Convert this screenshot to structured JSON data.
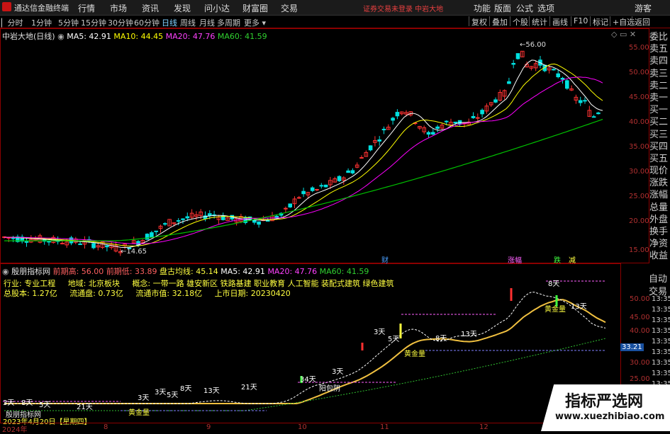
{
  "app": {
    "title": "通达信金融终端"
  },
  "menu": [
    "行情",
    "市场",
    "资讯",
    "发现",
    "问小达",
    "财富圈",
    "交易"
  ],
  "warning": "证券交易未登录  中岩大地",
  "top_right": [
    "功能",
    "版面",
    "公式",
    "选项"
  ],
  "guest": "游客",
  "periods": [
    "分时",
    "1分钟",
    "5分钟",
    "15分钟",
    "30分钟",
    "60分钟",
    "日线",
    "周线",
    "月线",
    "多周期",
    "更多"
  ],
  "active_period": "日线",
  "toolbar": [
    "复权",
    "叠加",
    "个股",
    "统计",
    "画线",
    "F10",
    "标记",
    "+自选",
    "返回"
  ],
  "main_legend": {
    "name": "中岩大地(日线)",
    "ma5": "MA5: 42.91",
    "ma10": "MA10: 44.45",
    "ma20": "MA20: 47.76",
    "ma60": "MA60: 41.59"
  },
  "main_axis": [
    "55.00",
    "50.00",
    "45.00",
    "40.00",
    "35.00",
    "30.00",
    "25.00",
    "20.00",
    "15.00"
  ],
  "annotations": {
    "high": "56.00",
    "low": "14.65",
    "cai": "财",
    "zhangting": "涨幅",
    "die": "跌",
    "jian": "减"
  },
  "right_panel": [
    "委比",
    "卖五",
    "卖四",
    "卖三",
    "卖二",
    "卖一",
    "买一",
    "买二",
    "买三",
    "买四",
    "买五",
    "现价",
    "涨跌",
    "涨幅",
    "总量",
    "外盘",
    "换手",
    "净资",
    "收益"
  ],
  "right_panel2": [
    "自动",
    "交易"
  ],
  "sub_legend": {
    "name": "殷朋指标网",
    "high_label": "前期高: 56.00",
    "low_label": "前期低: 33.89",
    "pangu": "盘古均线: 45.14",
    "ma5": "MA5: 42.91",
    "ma20": "MA20: 47.76",
    "ma60": "MA60: 41.59"
  },
  "info": {
    "industry": "行业: 专业工程",
    "region": "地域: 北京板块",
    "concept": "概念: 一带一路 雄安新区 铁路基建 职业教育 人工智能 装配式建筑 绿色建筑",
    "total_shares": "总股本: 1.27亿",
    "float_shares": "流通盘: 0.73亿",
    "float_value": "流通市值: 32.18亿",
    "listed": "上市日期: 20230420"
  },
  "sub_axis": [
    "50.00",
    "45.00",
    "40.00",
    "35.00",
    "30.00",
    "25.00"
  ],
  "sub_value": "33.21",
  "time_axis": [
    "13:35",
    "13:35",
    "13:35",
    "13:35",
    "13:35",
    "13:35",
    "13:35",
    "13:35",
    "13:35"
  ],
  "sub_labels": [
    "8天",
    "3天",
    "5天",
    "21天",
    "黄金量",
    "13天",
    "3天",
    "5天",
    "3天",
    "3天",
    "8天",
    "黄金量",
    "34天",
    "21天",
    "阳包阴",
    "13天",
    "8天",
    "5天",
    "3天",
    "13天",
    "8天",
    "黄金量"
  ],
  "sub_bottom": [
    "殷朋指标网",
    "2023年4月20日【星期四】"
  ],
  "x_axis": {
    "year": "2024年",
    "months": [
      "8",
      "9",
      "10",
      "11",
      "12"
    ]
  },
  "watermark": {
    "cn": "指标严选网",
    "url": "www.xuezhibiao.com"
  },
  "colors": {
    "up": "#ff3232",
    "down": "#00e0e0",
    "ma5": "#ffffff",
    "ma10": "#ffff00",
    "ma20": "#ff00ff",
    "ma60": "#00c000"
  }
}
